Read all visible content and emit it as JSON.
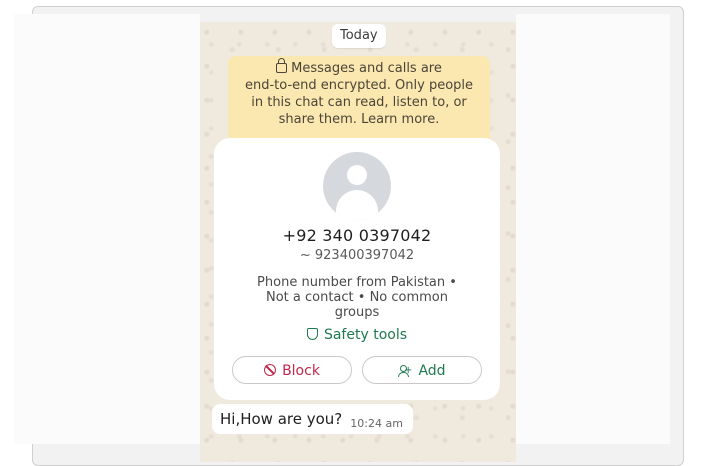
{
  "date_chip": "Today",
  "encryption_notice": {
    "line1": "Messages and calls are",
    "line2": "end-to-end encrypted. Only people",
    "line3": "in this chat can read, listen to, or",
    "line4": "share them. Learn more."
  },
  "contact": {
    "phone": "+92 340 0397042",
    "alias": "~ 923400397042",
    "meta_line1": "Phone number from Pakistan •",
    "meta_line2": "Not a contact • No common",
    "meta_line3": "groups",
    "safety_tools": "Safety tools"
  },
  "actions": {
    "block_label": "Block",
    "add_label": "Add"
  },
  "message": {
    "text": "Hi,How are you?",
    "time": "10:24 am"
  },
  "icons": {
    "lock": "lock-icon",
    "avatar": "avatar-placeholder",
    "shield": "shield-icon",
    "block": "block-icon",
    "add": "add-contact-icon"
  },
  "colors": {
    "encryption_bg": "#fbe7b0",
    "block": "#c0294b",
    "add": "#1e7a4f",
    "chat_bg": "#efe9de"
  }
}
